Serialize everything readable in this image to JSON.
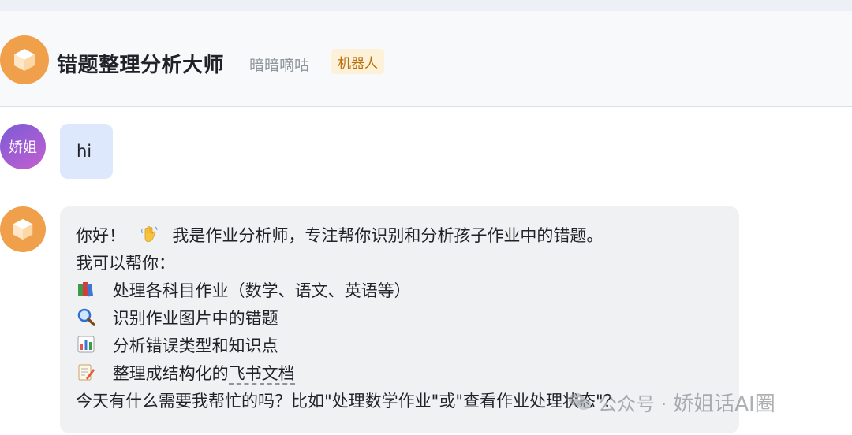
{
  "header": {
    "bot_name": "错题整理分析大师",
    "owner": "暗暗嘀咕",
    "tag": "机器人"
  },
  "user": {
    "avatar_text": "娇姐",
    "message": "hi"
  },
  "bot_reply": {
    "greeting_before": "你好！",
    "greeting_after": "我是作业分析师，专注帮你识别和分析孩子作业中的错题。",
    "intro": "我可以帮你：",
    "items": [
      {
        "icon": "books-icon",
        "text": "处理各科目作业（数学、语文、英语等）"
      },
      {
        "icon": "magnifier-icon",
        "text": "识别作业图片中的错题"
      },
      {
        "icon": "bar-chart-icon",
        "text": "分析错误类型和知识点"
      },
      {
        "icon": "memo-icon",
        "text_before": "整理成结构化的",
        "link": "飞书文档"
      }
    ],
    "closing": "今天有什么需要我帮忙的吗？比如\"处理数学作业\"或\"查看作业处理状态\"？"
  },
  "watermark": {
    "prefix": "公众号 ·",
    "name": "娇姐话AI圈"
  },
  "colors": {
    "bot_avatar": "#f0a04b",
    "user_bubble": "#dde8fd",
    "bot_bubble": "#f0f1f3",
    "tag_bg": "#fdf1da",
    "tag_text": "#b8700b"
  }
}
